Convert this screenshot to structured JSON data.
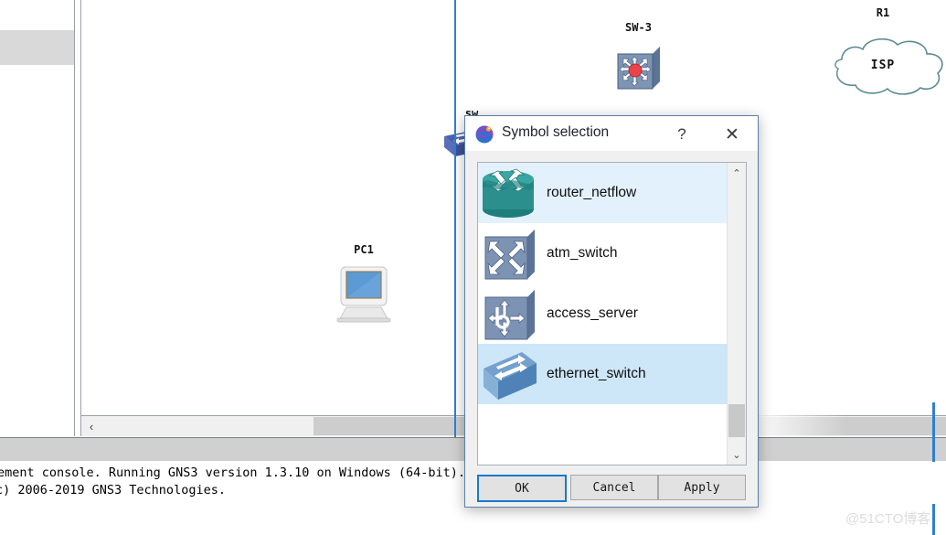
{
  "app": {
    "window_accent_color": "#2f7fd1"
  },
  "canvas": {
    "nodes": [
      {
        "id": "sw3",
        "label": "SW-3",
        "icon": "multilayer-switch-icon"
      },
      {
        "id": "sw",
        "label": "sw",
        "icon": "ethernet-switch-icon"
      },
      {
        "id": "pc1",
        "label": "PC1",
        "icon": "computer-icon"
      },
      {
        "id": "isp",
        "label": "R1",
        "inner_text": "ISP",
        "icon": "cloud-icon"
      }
    ],
    "hscrollbar": {
      "left_arrow": "‹"
    }
  },
  "console": {
    "line1": "ement console. Running GNS3 version 1.3.10 on Windows (64-bit).",
    "line2": "c) 2006-2019 GNS3 Technologies."
  },
  "dialog": {
    "title": "Symbol selection",
    "icon": "gns3-logo-icon",
    "help_glyph": "?",
    "close_glyph": "✕",
    "scrollbar": {
      "up_glyph": "⌃",
      "down_glyph": "⌄"
    },
    "symbols": [
      {
        "name": "router_netflow",
        "icon": "router-netflow-icon",
        "state": "hover"
      },
      {
        "name": "atm_switch",
        "icon": "atm-switch-icon",
        "state": "normal"
      },
      {
        "name": "access_server",
        "icon": "access-server-icon",
        "state": "normal"
      },
      {
        "name": "ethernet_switch",
        "icon": "ethernet-switch-icon",
        "state": "selected"
      }
    ],
    "buttons": {
      "ok": "OK",
      "cancel": "Cancel",
      "apply": "Apply"
    }
  },
  "watermark": "@51CTO博客"
}
